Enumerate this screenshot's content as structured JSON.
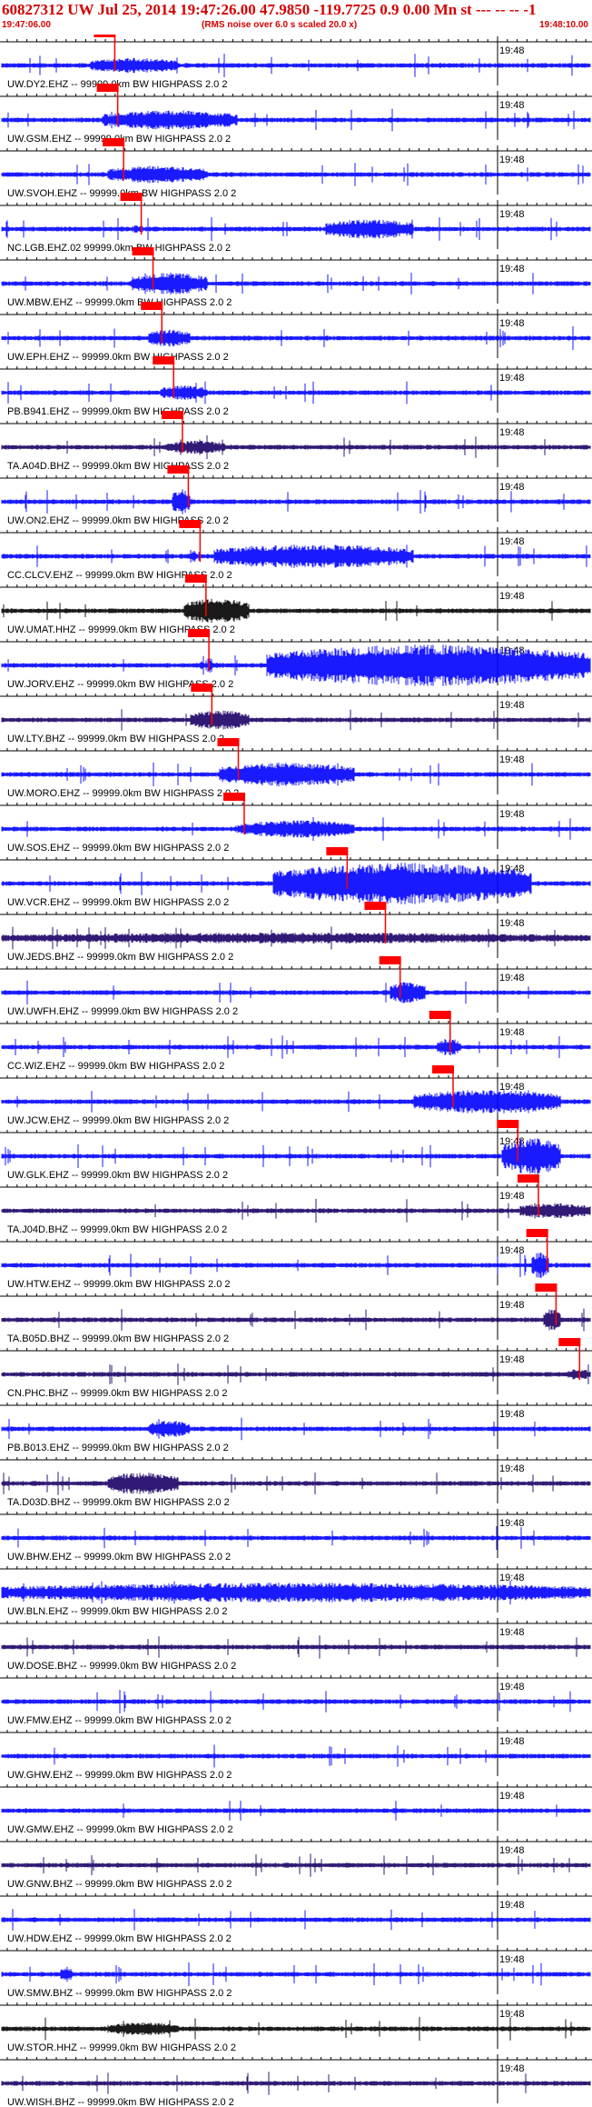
{
  "header": {
    "title": "60827312 UW Jul 25, 2014 19:47:26.00   47.9850 -119.7725  0.9 0.00 Mn st --- -- -- -1",
    "start_time": "19:47:06.00",
    "noise_note": "(RMS noise over 6.0 s scaled 20.0 x)",
    "end_time": "19:48:10.00"
  },
  "time_tick_label": "19:48",
  "colors": {
    "header_text": "#d40000",
    "pick": "#ff0000",
    "trace_blue": "#0000ff",
    "trace_black": "#000000",
    "trace_navy": "#1a0066"
  },
  "traces": [
    {
      "label": "UW.DY2.EHZ -- 99999.0km BW  HIGHPASS  2.0  2",
      "pick": 0.175,
      "color": "blue",
      "burst": [
        0.15,
        0.3
      ],
      "amp": 0.35
    },
    {
      "label": "UW.GSM.EHZ -- 99999.0km BW  HIGHPASS  2.0  2",
      "pick": 0.18,
      "color": "blue",
      "burst": [
        0.17,
        0.4
      ],
      "amp": 0.45
    },
    {
      "label": "UW.SVOH.EHZ -- 99999.0km BW  HIGHPASS  2.0  2",
      "pick": 0.19,
      "color": "blue",
      "burst": [
        0.18,
        0.35
      ],
      "amp": 0.4
    },
    {
      "label": "NC.LGB.EHZ.02 99999.0km BW  HIGHPASS  2.0  2",
      "pick": 0.22,
      "color": "blue",
      "burst": [
        0.55,
        0.7
      ],
      "amp": 0.45
    },
    {
      "label": "UW.MBW.EHZ -- 99999.0km BW  HIGHPASS  2.0  2",
      "pick": 0.24,
      "color": "blue",
      "burst": [
        0.22,
        0.35
      ],
      "amp": 0.5
    },
    {
      "label": "UW.EPH.EHZ -- 99999.0km BW  HIGHPASS  2.0  2",
      "pick": 0.255,
      "color": "blue",
      "burst": [
        0.25,
        0.32
      ],
      "amp": 0.4
    },
    {
      "label": "PB.B941.EHZ -- 99999.0km BW  HIGHPASS  2.0  2",
      "pick": 0.275,
      "color": "blue",
      "burst": [
        0.27,
        0.35
      ],
      "amp": 0.35
    },
    {
      "label": "TA.A04D.BHZ -- 99999.0km BW  HIGHPASS  2.0  2",
      "pick": 0.29,
      "color": "navy",
      "burst": [
        0.28,
        0.38
      ],
      "amp": 0.3
    },
    {
      "label": "UW.ON2.EHZ -- 99999.0km BW  HIGHPASS  2.0  2",
      "pick": 0.3,
      "color": "blue",
      "burst": [
        0.29,
        0.32
      ],
      "amp": 0.6
    },
    {
      "label": "CC.CLCV.EHZ -- 99999.0km BW  HIGHPASS  2.0  2",
      "pick": 0.32,
      "color": "blue",
      "burst": [
        0.36,
        0.7
      ],
      "amp": 0.55
    },
    {
      "label": "UW.UMAT.HHZ -- 99999.0km BW  HIGHPASS  2.0  2",
      "pick": 0.33,
      "color": "black",
      "burst": [
        0.31,
        0.42
      ],
      "amp": 0.6
    },
    {
      "label": "UW.JORV.EHZ -- 99999.0km BW  HIGHPASS  2.0  2",
      "pick": 0.335,
      "color": "blue",
      "burst": [
        0.45,
        1.0
      ],
      "amp": 0.95
    },
    {
      "label": "UW.LTY.BHZ -- 99999.0km BW  HIGHPASS  2.0  2",
      "pick": 0.34,
      "color": "navy",
      "burst": [
        0.32,
        0.42
      ],
      "amp": 0.45
    },
    {
      "label": "UW.MORO.EHZ -- 99999.0km BW  HIGHPASS  2.0  2",
      "pick": 0.385,
      "color": "blue",
      "burst": [
        0.37,
        0.6
      ],
      "amp": 0.55
    },
    {
      "label": "UW.SOS.EHZ -- 99999.0km BW  HIGHPASS  2.0  2",
      "pick": 0.395,
      "color": "blue",
      "burst": [
        0.4,
        0.6
      ],
      "amp": 0.4
    },
    {
      "label": "UW.VCR.EHZ -- 99999.0km BW  HIGHPASS  2.0  2",
      "pick": 0.57,
      "color": "blue",
      "burst": [
        0.46,
        0.9
      ],
      "amp": 0.95
    },
    {
      "label": "UW.JEDS.BHZ -- 99999.0km BW  HIGHPASS  2.0  2",
      "pick": 0.635,
      "color": "navy",
      "burst": [
        0.0,
        1.0
      ],
      "amp": 0.25
    },
    {
      "label": "UW.UWFH.EHZ -- 99999.0km BW  HIGHPASS  2.0  2",
      "pick": 0.66,
      "color": "blue",
      "burst": [
        0.66,
        0.72
      ],
      "amp": 0.5
    },
    {
      "label": "CC.WIZ.EHZ -- 99999.0km BW  HIGHPASS  2.0  2",
      "pick": 0.745,
      "color": "blue",
      "burst": [
        0.74,
        0.78
      ],
      "amp": 0.4
    },
    {
      "label": "UW.JCW.EHZ -- 99999.0km BW  HIGHPASS  2.0  2",
      "pick": 0.75,
      "color": "blue",
      "burst": [
        0.7,
        0.95
      ],
      "amp": 0.55
    },
    {
      "label": "UW.GLK.EHZ -- 99999.0km BW  HIGHPASS  2.0  2",
      "pick": 0.86,
      "color": "blue",
      "burst": [
        0.85,
        0.95
      ],
      "amp": 0.85
    },
    {
      "label": "TA.J04D.BHZ -- 99999.0km BW  HIGHPASS  2.0  2",
      "pick": 0.895,
      "color": "navy",
      "burst": [
        0.88,
        1.0
      ],
      "amp": 0.35
    },
    {
      "label": "UW.HTW.EHZ -- 99999.0km BW  HIGHPASS  2.0  2",
      "pick": 0.91,
      "color": "blue",
      "burst": [
        0.9,
        0.93
      ],
      "amp": 0.6
    },
    {
      "label": "TA.B05D.BHZ -- 99999.0km BW  HIGHPASS  2.0  2",
      "pick": 0.925,
      "color": "navy",
      "burst": [
        0.92,
        0.95
      ],
      "amp": 0.5
    },
    {
      "label": "CN.PHC.BHZ -- 99999.0km BW  HIGHPASS  2.0  2",
      "pick": 0.965,
      "color": "navy",
      "burst": [
        0.96,
        1.0
      ],
      "amp": 0.25
    },
    {
      "label": "PB.B013.EHZ -- 99999.0km BW  HIGHPASS  2.0  2",
      "pick": null,
      "color": "blue",
      "burst": [
        0.25,
        0.32
      ],
      "amp": 0.4
    },
    {
      "label": "TA.D03D.BHZ -- 99999.0km BW  HIGHPASS  2.0  2",
      "pick": null,
      "color": "navy",
      "burst": [
        0.18,
        0.3
      ],
      "amp": 0.5
    },
    {
      "label": "UW.BHW.EHZ -- 99999.0km BW  HIGHPASS  2.0  2",
      "pick": null,
      "color": "blue",
      "burst": [
        0.0,
        0.0
      ],
      "amp": 0.2
    },
    {
      "label": "UW.BLN.EHZ -- 99999.0km BW  HIGHPASS  2.0  2",
      "pick": null,
      "color": "blue",
      "burst": [
        0.0,
        1.0
      ],
      "amp": 0.45
    },
    {
      "label": "UW.DOSE.BHZ -- 99999.0km BW  HIGHPASS  2.0  2",
      "pick": null,
      "color": "navy",
      "burst": [
        0.0,
        0.0
      ],
      "amp": 0.2
    },
    {
      "label": "UW.FMW.EHZ -- 99999.0km BW  HIGHPASS  2.0  2",
      "pick": null,
      "color": "blue",
      "burst": [
        0.0,
        0.0
      ],
      "amp": 0.3
    },
    {
      "label": "UW.GHW.EHZ -- 99999.0km BW  HIGHPASS  2.0  2",
      "pick": null,
      "color": "blue",
      "burst": [
        0.0,
        0.0
      ],
      "amp": 0.35
    },
    {
      "label": "UW.GMW.EHZ -- 99999.0km BW  HIGHPASS  2.0  2",
      "pick": null,
      "color": "blue",
      "burst": [
        0.0,
        0.0
      ],
      "amp": 0.25
    },
    {
      "label": "UW.GNW.BHZ -- 99999.0km BW  HIGHPASS  2.0  2",
      "pick": null,
      "color": "navy",
      "burst": [
        0.0,
        0.0
      ],
      "amp": 0.2
    },
    {
      "label": "UW.HDW.EHZ -- 99999.0km BW  HIGHPASS  2.0  2",
      "pick": null,
      "color": "blue",
      "burst": [
        0.0,
        0.0
      ],
      "amp": 0.2
    },
    {
      "label": "UW.SMW.BHZ -- 99999.0km BW  HIGHPASS  2.0  2",
      "pick": null,
      "color": "blue",
      "burst": [
        0.1,
        0.12
      ],
      "amp": 0.35
    },
    {
      "label": "UW.STOR.HHZ -- 99999.0km BW  HIGHPASS  2.0  2",
      "pick": null,
      "color": "black",
      "burst": [
        0.18,
        0.3
      ],
      "amp": 0.3
    },
    {
      "label": "UW.WISH.BHZ -- 99999.0km BW  HIGHPASS  2.0  2",
      "pick": null,
      "color": "navy",
      "burst": [
        0.0,
        0.0
      ],
      "amp": 0.25
    }
  ]
}
